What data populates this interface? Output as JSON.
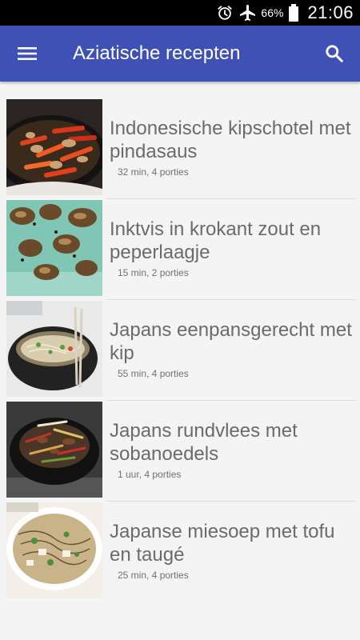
{
  "status_bar": {
    "battery_percent": "66%",
    "time": "21:06",
    "icons": [
      "alarm-icon",
      "airplane-mode-icon",
      "battery-icon"
    ]
  },
  "app_bar": {
    "title": "Aziatische recepten",
    "menu_icon": "hamburger-menu-icon",
    "search_icon": "search-icon",
    "color": "#3f51b5"
  },
  "recipes": [
    {
      "title": "Indonesische kipschotel met pindasaus",
      "meta": "32 min, 4 porties"
    },
    {
      "title": "Inktvis in krokant zout en peperlaagje",
      "meta": "15 min, 2 porties"
    },
    {
      "title": "Japans eenpansgerecht met kip",
      "meta": "55 min, 4 porties"
    },
    {
      "title": "Japans rundvlees met sobanoedels",
      "meta": "1 uur, 4 porties"
    },
    {
      "title": "Japanse miesoep met tofu en taugé",
      "meta": "25 min, 4 porties"
    }
  ]
}
